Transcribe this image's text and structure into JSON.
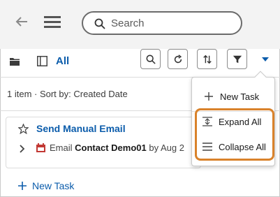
{
  "header": {
    "search_placeholder": "Search"
  },
  "toolbar": {
    "view_label": "All"
  },
  "list": {
    "meta": "1 item · Sort by: Created Date",
    "task": {
      "title": "Send Manual Email",
      "type": "Email",
      "contact": "Contact Demo01",
      "by_text": "by Aug 2"
    },
    "new_task_label": "New Task"
  },
  "menu": {
    "new_task": "New Task",
    "expand_all": "Expand All",
    "collapse_all": "Collapse All"
  },
  "colors": {
    "accent": "#0b5cab",
    "highlight": "#d9822b",
    "calendar_icon": "#c23934"
  }
}
